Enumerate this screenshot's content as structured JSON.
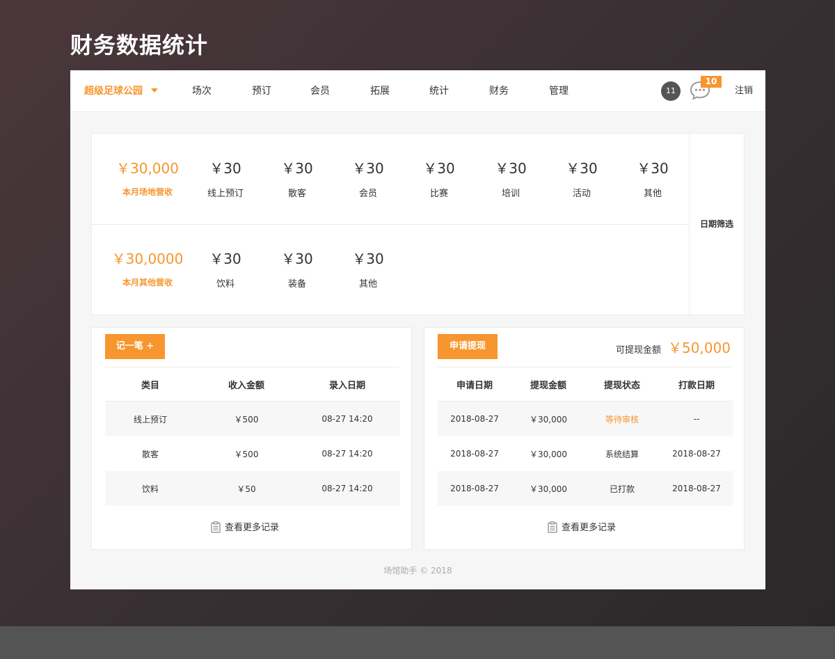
{
  "page": {
    "heading": "财务数据统计"
  },
  "nav": {
    "brand": "超级足球公园",
    "items": [
      "场次",
      "预订",
      "会员",
      "拓展",
      "统计",
      "财务",
      "管理"
    ],
    "notification_count": "11",
    "message_count": "10",
    "logout": "注销"
  },
  "stats": {
    "venue": {
      "total": {
        "value": "￥30,000",
        "label": "本月场地营收"
      },
      "items": [
        {
          "value": "￥30",
          "label": "线上预订"
        },
        {
          "value": "￥30",
          "label": "散客"
        },
        {
          "value": "￥30",
          "label": "会员"
        },
        {
          "value": "￥30",
          "label": "比赛"
        },
        {
          "value": "￥30",
          "label": "培训"
        },
        {
          "value": "￥30",
          "label": "活动"
        },
        {
          "value": "￥30",
          "label": "其他"
        }
      ]
    },
    "other": {
      "total": {
        "value": "￥30,0000",
        "label": "本月其他营收"
      },
      "items": [
        {
          "value": "￥30",
          "label": "饮料"
        },
        {
          "value": "￥30",
          "label": "装备"
        },
        {
          "value": "￥30",
          "label": "其他"
        }
      ]
    },
    "date_filter": "日期筛选"
  },
  "income": {
    "button": "记一笔 +",
    "headers": [
      "类目",
      "收入金额",
      "录入日期"
    ],
    "rows": [
      [
        "线上预订",
        "￥500",
        "08-27 14:20"
      ],
      [
        "散客",
        "￥500",
        "08-27 14:20"
      ],
      [
        "饮料",
        "￥50",
        "08-27 14:20"
      ]
    ],
    "more": "查看更多记录"
  },
  "withdraw": {
    "button": "申请提现",
    "available_label": "可提现金额",
    "available_value": "￥50,000",
    "headers": [
      "申请日期",
      "提现金额",
      "提现状态",
      "打款日期"
    ],
    "rows": [
      [
        "2018-08-27",
        "￥30,000",
        "等待审核",
        "--"
      ],
      [
        "2018-08-27",
        "￥30,000",
        "系统结算",
        "2018-08-27"
      ],
      [
        "2018-08-27",
        "￥30,000",
        "已打款",
        "2018-08-27"
      ]
    ],
    "more": "查看更多记录"
  },
  "footer": "场馆助手 © 2018",
  "colors": {
    "accent": "#f7962e",
    "badge": "#555555"
  },
  "icons": {
    "caret": "caret-down-icon",
    "message": "chat-bubble-icon",
    "more": "clipboard-icon"
  }
}
